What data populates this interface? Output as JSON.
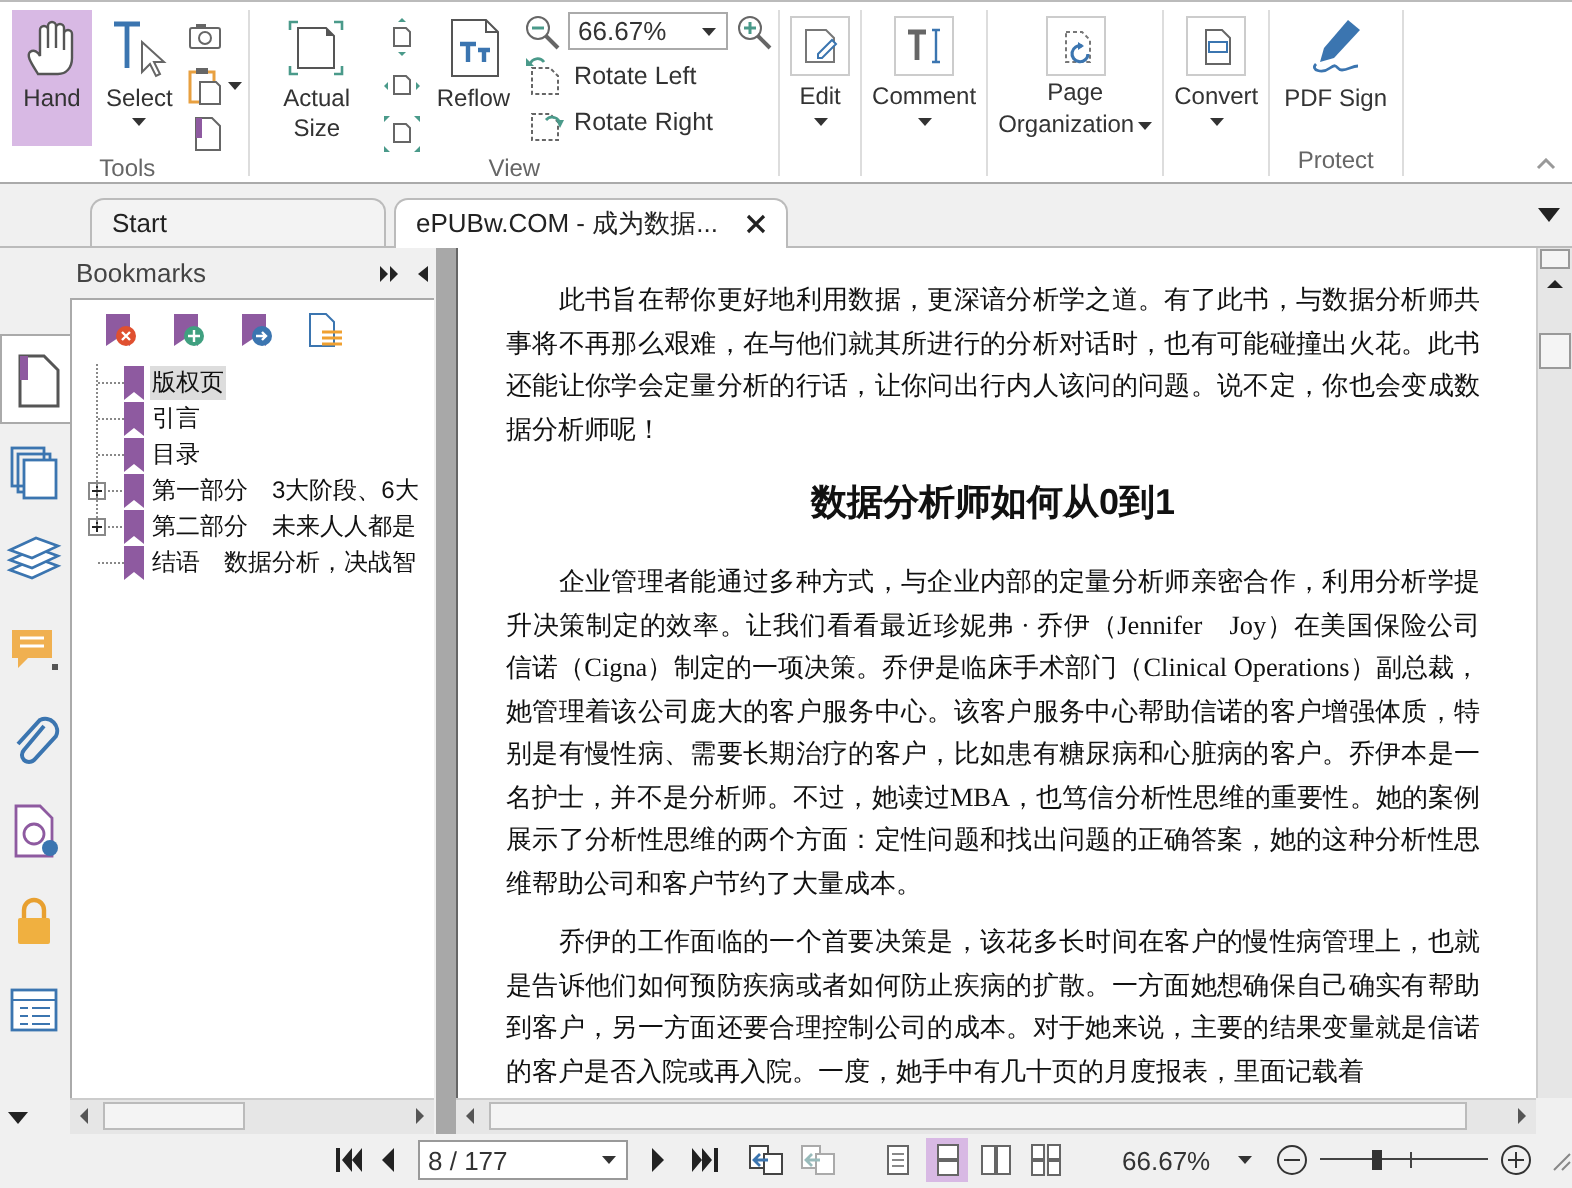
{
  "ribbon": {
    "groups": [
      {
        "label": "Tools",
        "items": [
          {
            "kind": "large",
            "label": "Hand",
            "selected": true,
            "dropdown": false
          },
          {
            "kind": "large",
            "label": "Select",
            "selected": false,
            "dropdown": true
          },
          {
            "kind": "stack",
            "buttons": [
              {
                "dropdown": false
              },
              {
                "dropdown": true
              },
              {
                "dropdown": false
              }
            ]
          }
        ]
      },
      {
        "label": "View",
        "items": [
          {
            "kind": "large",
            "label": "Actual Size",
            "dropdown": false
          },
          {
            "kind": "stack",
            "buttons": [
              {
                "dropdown": false
              },
              {
                "dropdown": false
              },
              {
                "dropdown": false
              }
            ]
          },
          {
            "kind": "large",
            "label": "Reflow",
            "dropdown": false
          },
          {
            "kind": "zoom",
            "value": "66.67%",
            "commands": [
              "Rotate Left",
              "Rotate Right"
            ]
          }
        ]
      },
      {
        "items": [
          {
            "kind": "boxed",
            "label": "Edit",
            "dropdown": true
          }
        ]
      },
      {
        "items": [
          {
            "kind": "boxed",
            "label": "Comment",
            "dropdown": true
          }
        ]
      },
      {
        "items": [
          {
            "kind": "boxed",
            "label": "Page Organization",
            "dropdown": true
          }
        ]
      },
      {
        "items": [
          {
            "kind": "boxed",
            "label": "Convert",
            "dropdown": true
          }
        ]
      },
      {
        "label": "Protect",
        "items": [
          {
            "kind": "large",
            "label": "PDF Sign",
            "dropdown": false
          }
        ]
      }
    ]
  },
  "tabs": [
    {
      "label": "Start",
      "selected": false,
      "closable": false
    },
    {
      "label": "ePUBw.COM - 成为数据...",
      "selected": true,
      "closable": true
    }
  ],
  "sidebar": {
    "items": [
      {
        "selected": true
      },
      {
        "selected": false
      },
      {
        "selected": false
      },
      {
        "selected": false
      },
      {
        "selected": false
      },
      {
        "selected": false
      },
      {
        "selected": false
      },
      {
        "selected": false
      }
    ]
  },
  "bookmarks": {
    "title": "Bookmarks",
    "items": [
      {
        "label": "版权页",
        "selected": true,
        "expandable": false
      },
      {
        "label": "引言",
        "selected": false,
        "expandable": false
      },
      {
        "label": "目录",
        "selected": false,
        "expandable": false
      },
      {
        "label": "第一部分　3大阶段、6大",
        "selected": false,
        "expandable": true
      },
      {
        "label": "第二部分　未来人人都是",
        "selected": false,
        "expandable": true
      },
      {
        "label": "结语　数据分析，决战智",
        "selected": false,
        "expandable": false
      }
    ]
  },
  "document": {
    "blocks": [
      {
        "kind": "paragraph",
        "text": "此书旨在帮你更好地利用数据，更深谙分析学之道。有了此书，与数据分析师共事将不再那么艰难，在与他们就其所进行的分析对话时，也有可能碰撞出火花。此书还能让你学会定量分析的行话，让你问出行内人该问的问题。说不定，你也会变成数据分析师呢！"
      },
      {
        "kind": "heading",
        "text": "数据分析师如何从0到1"
      },
      {
        "kind": "paragraph",
        "text": "企业管理者能通过多种方式，与企业内部的定量分析师亲密合作，利用分析学提升决策制定的效率。让我们看看最近珍妮弗 · 乔伊（Jennifer　Joy）在美国保险公司信诺（Cigna）制定的一项决策。乔伊是临床手术部门（Clinical Operations）副总裁，她管理着该公司庞大的客户服务中心。该客户服务中心帮助信诺的客户增强体质，特别是有慢性病、需要长期治疗的客户，比如患有糖尿病和心脏病的客户。乔伊本是一名护士，并不是分析师。不过，她读过MBA，也笃信分析性思维的重要性。她的案例展示了分析性思维的两个方面：定性问题和找出问题的正确答案，她的这种分析性思维帮助公司和客户节约了大量成本。"
      },
      {
        "kind": "paragraph",
        "text": "乔伊的工作面临的一个首要决策是，该花多长时间在客户的慢性病管理上，也就是告诉他们如何预防疾病或者如何防止疾病的扩散。一方面她想确保自己确实有帮助到客户，另一方面还要合理控制公司的成本。对于她来说，主要的结果变量就是信诺的客户是否入院或再入院。一度，她手中有几十页的月度报表，里面记载着"
      }
    ]
  },
  "status_bar": {
    "page": "8 / 177",
    "history": [
      {
        "disabled": false
      },
      {
        "disabled": true
      }
    ],
    "layouts": [
      {
        "selected": false
      },
      {
        "selected": true
      },
      {
        "selected": false
      },
      {
        "selected": false
      }
    ],
    "zoom": "66.67%",
    "zoom_slider": {
      "level": 0.33
    }
  }
}
